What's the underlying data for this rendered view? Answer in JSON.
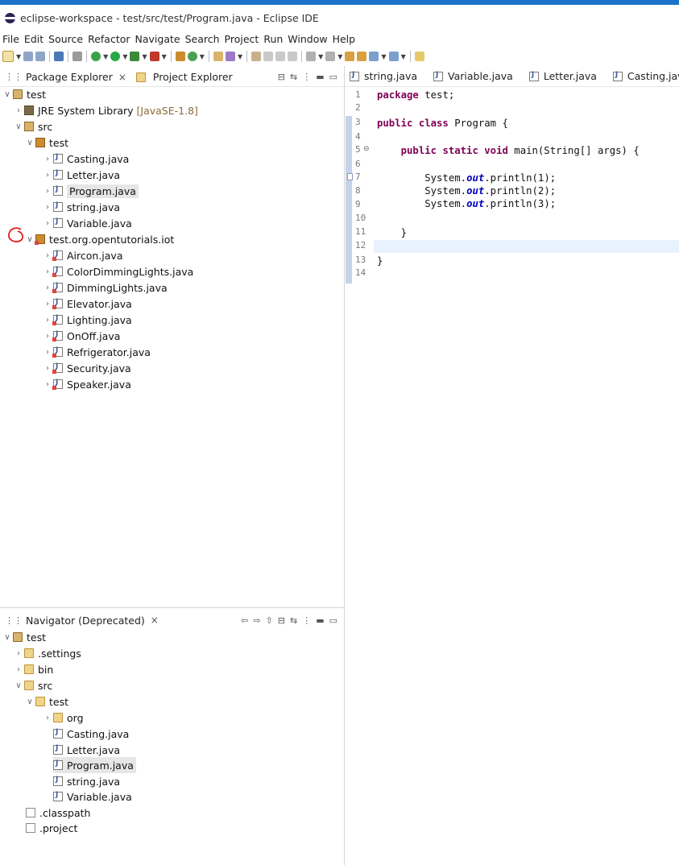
{
  "window": {
    "title": "eclipse-workspace - test/src/test/Program.java - Eclipse IDE"
  },
  "menu": [
    "File",
    "Edit",
    "Source",
    "Refactor",
    "Navigate",
    "Search",
    "Project",
    "Run",
    "Window",
    "Help"
  ],
  "package_explorer": {
    "tab_label": "Package Explorer",
    "other_tab_label": "Project Explorer",
    "tree": {
      "project": "test",
      "jre": "JRE System Library",
      "jre_version": "[JavaSE-1.8]",
      "src": "src",
      "pkg_test": "test",
      "test_files": [
        "Casting.java",
        "Letter.java",
        "Program.java",
        "string.java",
        "Variable.java"
      ],
      "pkg_iot": "test.org.opentutorials.iot",
      "iot_files": [
        "Aircon.java",
        "ColorDimmingLights.java",
        "DimmingLights.java",
        "Elevator.java",
        "Lighting.java",
        "OnOff.java",
        "Refrigerator.java",
        "Security.java",
        "Speaker.java"
      ]
    }
  },
  "navigator": {
    "tab_label": "Navigator (Deprecated)",
    "tree": {
      "project": "test",
      "settings": ".settings",
      "bin": "bin",
      "src": "src",
      "test": "test",
      "org": "org",
      "files": [
        "Casting.java",
        "Letter.java",
        "Program.java",
        "string.java",
        "Variable.java"
      ],
      "classpath": ".classpath",
      "project_file": ".project"
    }
  },
  "editor": {
    "tabs": [
      "string.java",
      "Variable.java",
      "Letter.java",
      "Casting.java"
    ],
    "line_numbers": [
      "1",
      "2",
      "3",
      "4",
      "5",
      "6",
      "7",
      "8",
      "9",
      "10",
      "11",
      "12",
      "13",
      "14"
    ],
    "code": {
      "l1_kw": "package",
      "l1_rest": " test;",
      "l3_kw": "public class",
      "l3_rest": " Program {",
      "l5_indent": "    ",
      "l5_kw": "public static void",
      "l5_rest": " main(String[] args) {",
      "print_prefix": "        System.",
      "print_field": "out",
      "l7_rest": ".println(1);",
      "l8_rest": ".println(2);",
      "l9_rest": ".println(3);",
      "l11": "    }",
      "l13": "}"
    }
  }
}
